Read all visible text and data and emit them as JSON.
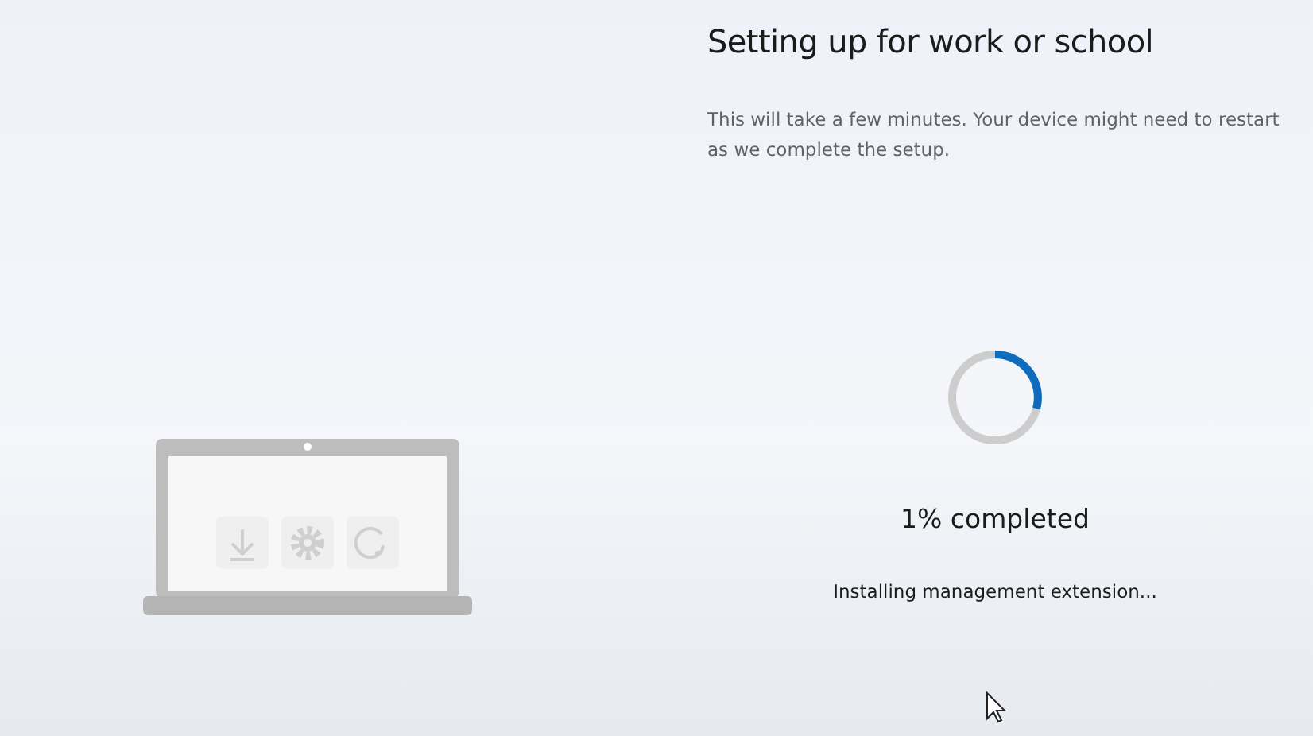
{
  "title": "Setting up for work or school",
  "description": "This will take a few minutes. Your device might need to restart as we complete the setup.",
  "progress_text": "1% completed",
  "status": "Installing management extension..."
}
